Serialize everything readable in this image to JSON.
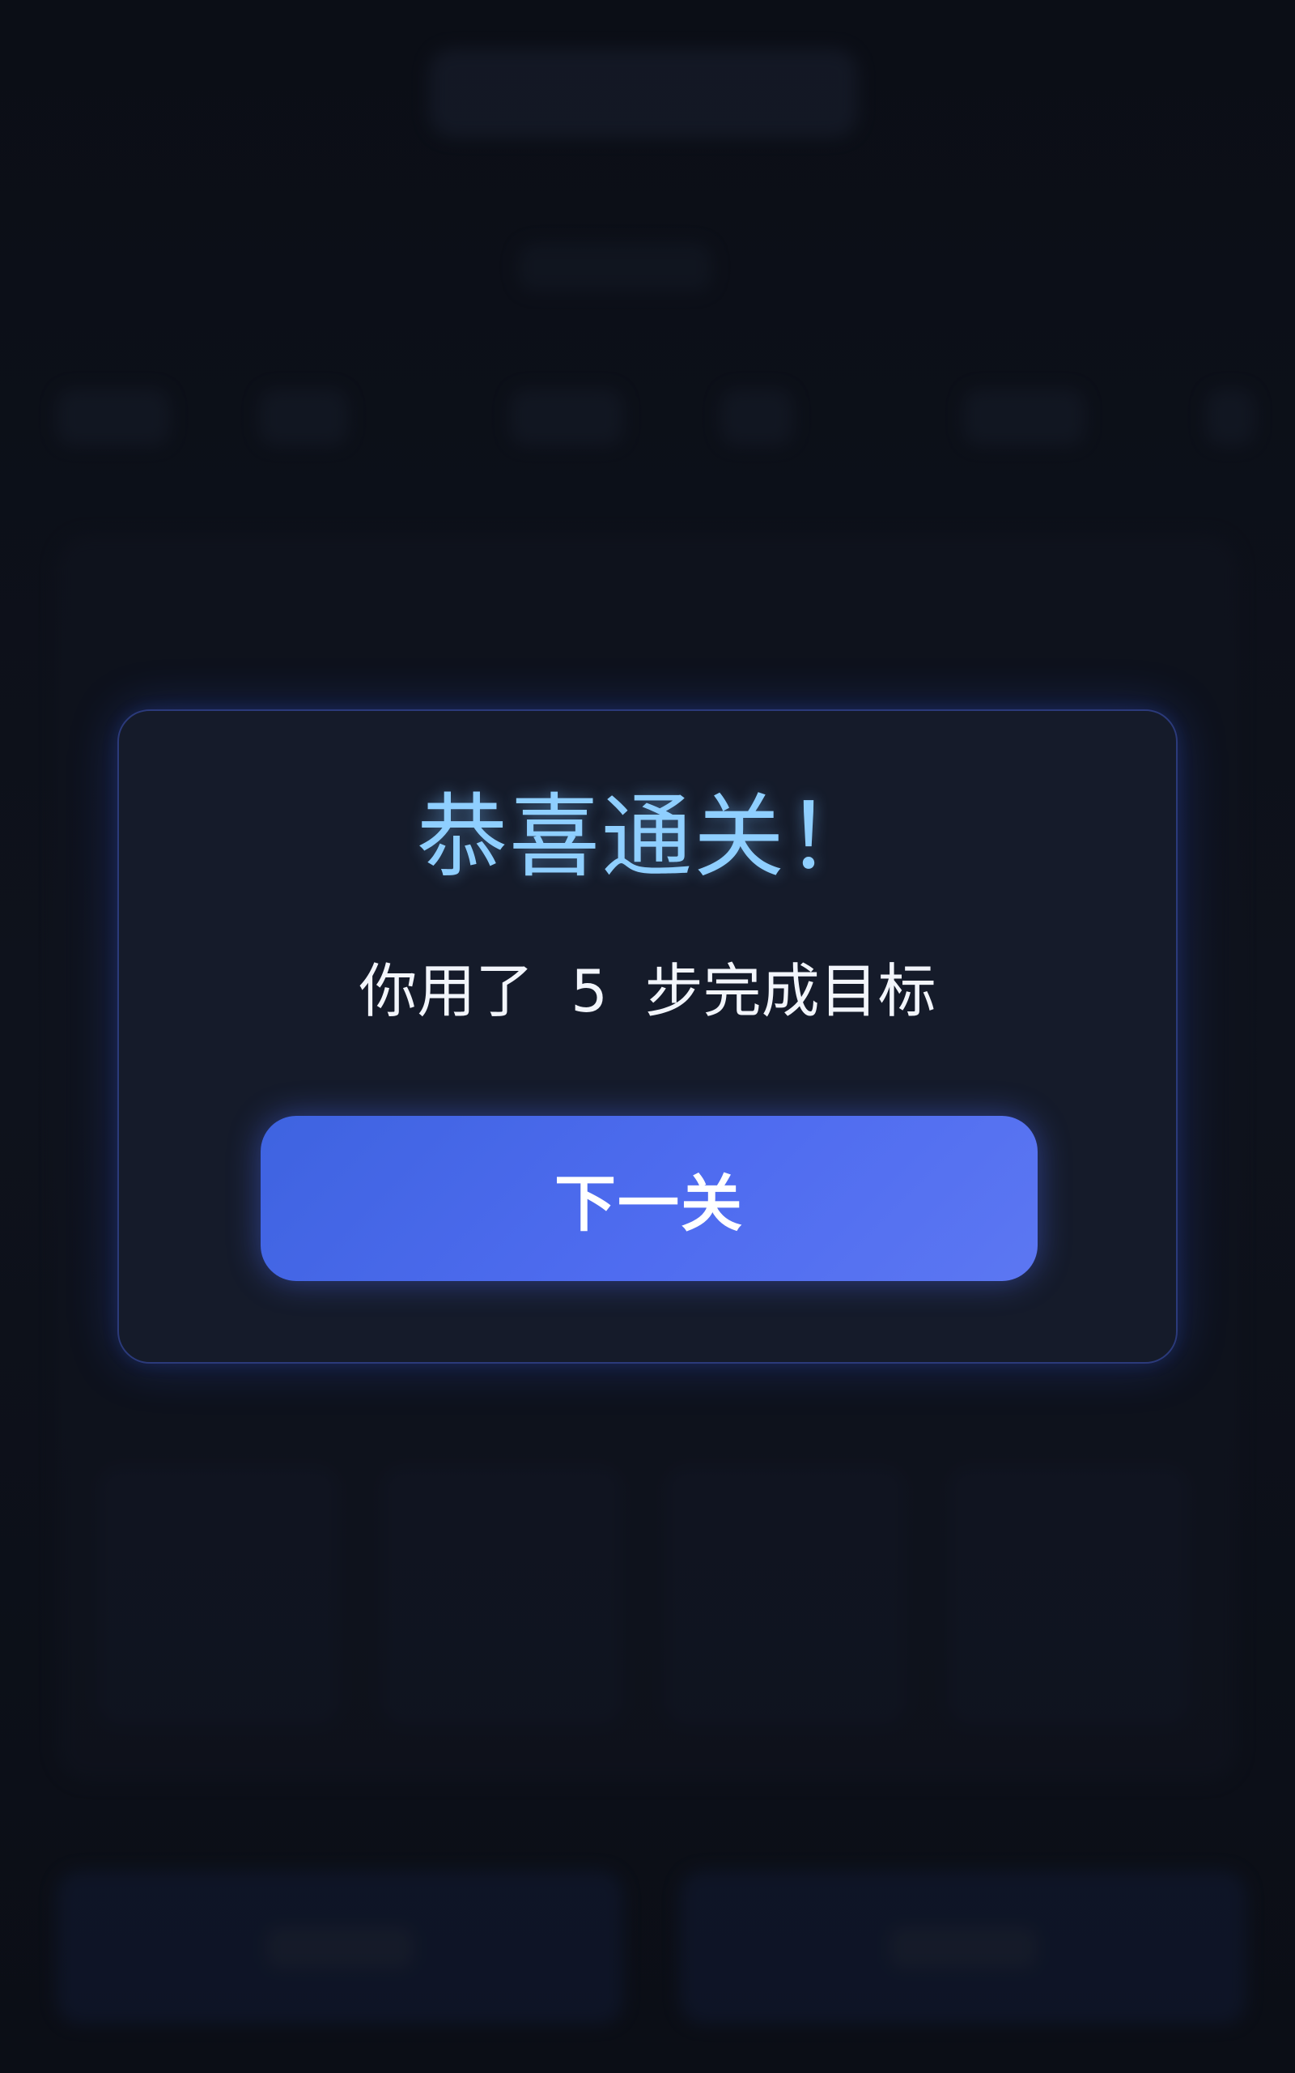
{
  "modal": {
    "title": "恭喜通关！",
    "message": "你用了  5  步完成目标",
    "next_button_label": "下一关"
  },
  "colors": {
    "title": "#8fcfff",
    "button": "#4f6cf0",
    "modal_border": "#2b3a7a",
    "background": "#0c0f17"
  }
}
